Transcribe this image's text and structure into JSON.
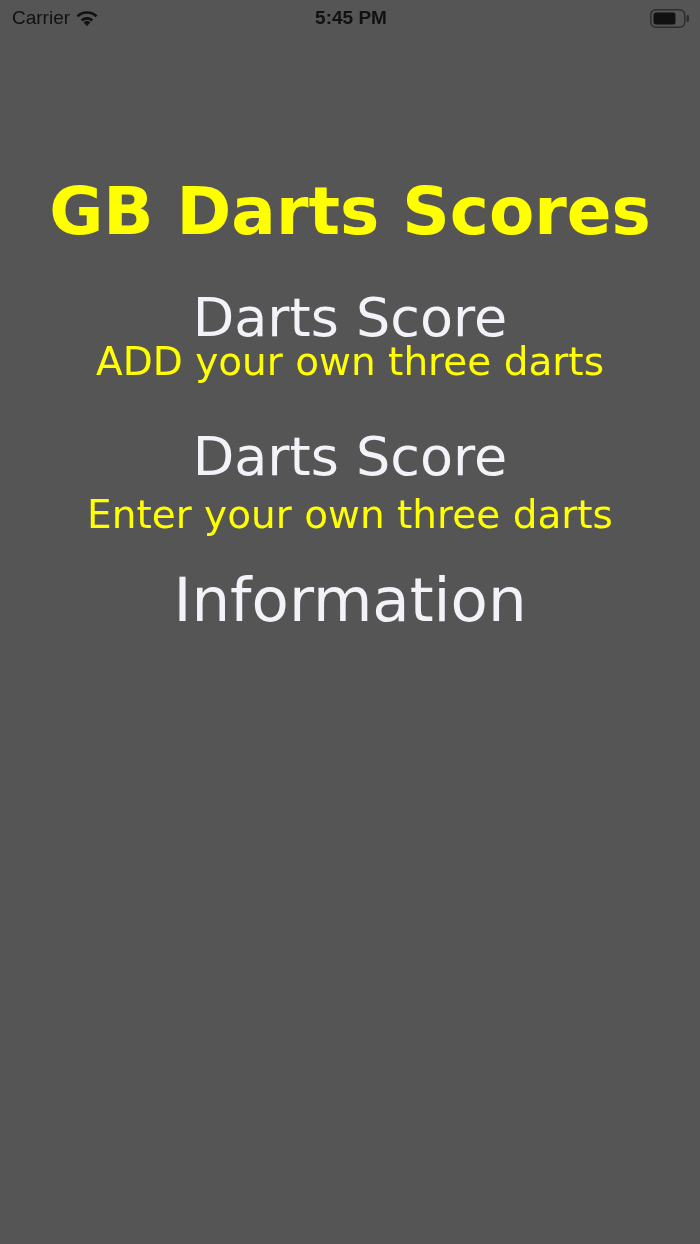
{
  "status_bar": {
    "carrier": "Carrier",
    "time": "5:45 PM"
  },
  "title": "GB Darts Scores",
  "menu": [
    {
      "label": "Darts Score",
      "subtitle": "ADD your own three darts"
    },
    {
      "label": "Darts Score",
      "subtitle": "Enter your own three darts"
    },
    {
      "label": "Information"
    }
  ]
}
